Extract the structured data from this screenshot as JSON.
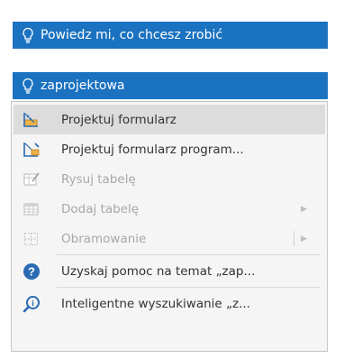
{
  "tell_me": {
    "placeholder": "Powiedz mi, co chcesz zrobić",
    "query": "zaprojektowa"
  },
  "menu": {
    "items": [
      {
        "label": "Projektuj formularz",
        "icon": "form-design-icon",
        "state": "highlighted"
      },
      {
        "label": "Projektuj formularz program...",
        "icon": "form-design-program-icon",
        "state": "enabled"
      },
      {
        "label": "Rysuj tabelę",
        "icon": "draw-table-icon",
        "state": "disabled"
      },
      {
        "label": "Dodaj tabelę",
        "icon": "table-icon",
        "state": "disabled",
        "submenu": true
      },
      {
        "label": "Obramowanie",
        "icon": "borders-icon",
        "state": "disabled",
        "submenu": true
      },
      {
        "label": "Uzyskaj pomoc na temat „zap...",
        "icon": "help-icon",
        "state": "enabled"
      },
      {
        "label": "Inteligentne wyszukiwanie „z...",
        "icon": "smart-lookup-icon",
        "state": "enabled"
      }
    ]
  },
  "colors": {
    "accent": "#1a72c0",
    "highlight": "#dcdcdc",
    "menu_bg": "#f5f5f5",
    "disabled_text": "#a8a8a8",
    "help_blue": "#2a6ab1"
  }
}
